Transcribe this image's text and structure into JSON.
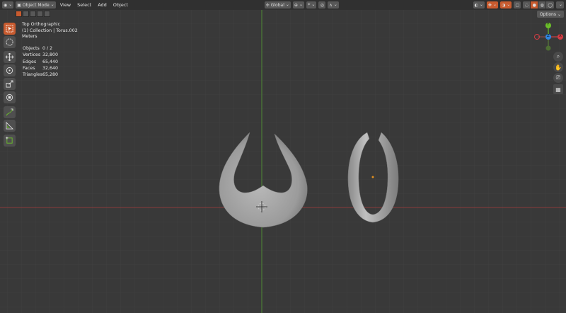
{
  "header": {
    "mode": "Object Mode",
    "menu": [
      "View",
      "Select",
      "Add",
      "Object"
    ],
    "orientation": "Global"
  },
  "options_label": "Options",
  "viewport": {
    "view_name": "Top Orthographic",
    "collection": "(1) Collection | Torus.002",
    "units": "Meters"
  },
  "stats": [
    {
      "label": "Objects",
      "value": "0 / 2"
    },
    {
      "label": "Vertices",
      "value": "32,800"
    },
    {
      "label": "Edges",
      "value": "65,440"
    },
    {
      "label": "Faces",
      "value": "32,640"
    },
    {
      "label": "Triangles",
      "value": "65,280"
    }
  ],
  "gizmo": {
    "x": "X",
    "y": "Y",
    "z": "Z"
  },
  "colors": {
    "x_axis": "#d23c43",
    "y_axis": "#6bbf2a",
    "z_axis": "#2f86e0",
    "accent": "#c85b2f",
    "viewport_bg": "#393939"
  },
  "toolbar_icons": [
    "select-box-icon",
    "select-circle-icon",
    "move-icon",
    "rotate-icon",
    "scale-icon",
    "transform-icon",
    "annotate-icon",
    "measure-icon",
    "add-cube-icon"
  ],
  "nav_icons": [
    "zoom-icon",
    "hand-pan-icon",
    "camera-icon",
    "grid-icon"
  ]
}
